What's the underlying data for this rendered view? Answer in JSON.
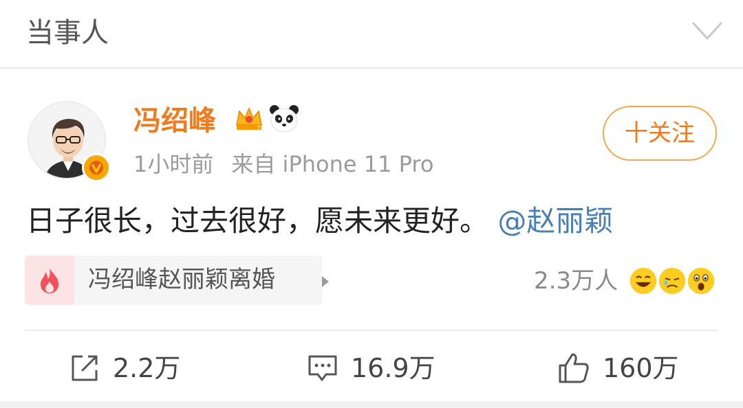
{
  "header": {
    "title": "当事人",
    "collapse_icon": "chevron-down-icon"
  },
  "post": {
    "username": "冯绍峰",
    "badges": [
      "crown-icon",
      "panda-icon"
    ],
    "verified_badge": "v",
    "time": "1小时前",
    "source": "来自 iPhone 11 Pro",
    "follow_label": "十关注",
    "content_text": "日子很长，过去很好，愿未来更好。",
    "mention": "@赵丽颖",
    "topic": {
      "icon": "fire-icon",
      "label": "冯绍峰赵丽颖离婚"
    },
    "reactions_count": "2.3万人",
    "actions": {
      "repost": "2.2万",
      "comment": "16.9万",
      "like": "160万"
    }
  },
  "colors": {
    "brand_orange": "#f07a1c",
    "mention_blue": "#4a7fb5",
    "text_gray": "#9b9b9b"
  }
}
